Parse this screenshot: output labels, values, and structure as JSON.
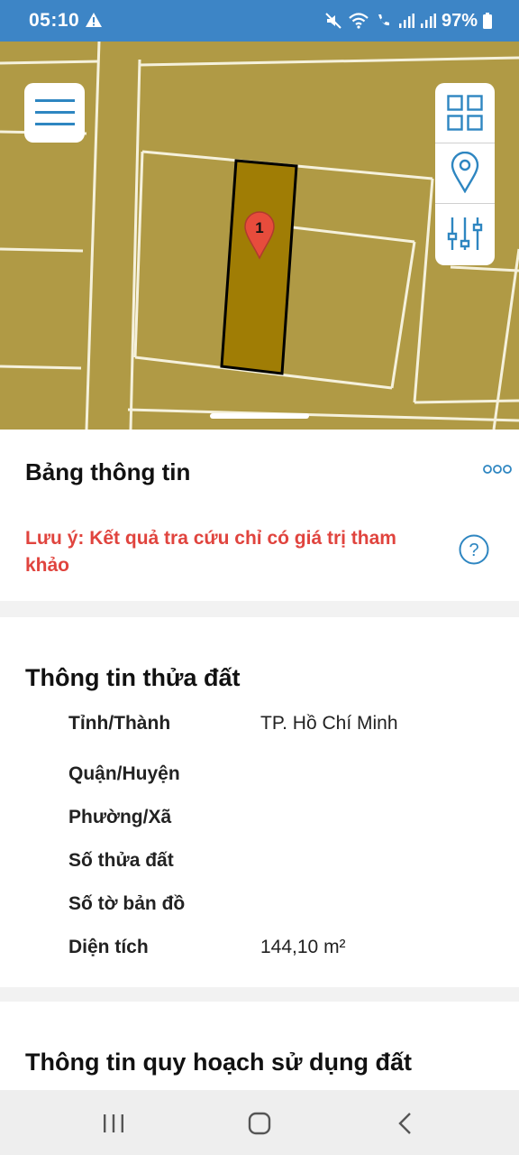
{
  "status": {
    "time": "05:10",
    "battery": "97%"
  },
  "map": {
    "marker_label": "1",
    "accent": "#2e86c1"
  },
  "panel": {
    "title": "Bảng thông tin",
    "note": "Lưu ý: Kết quả tra cứu chỉ có giá trị tham khảo"
  },
  "land_info": {
    "title": "Thông tin thửa đất",
    "rows": [
      {
        "label": "Tỉnh/Thành",
        "value": "TP. Hồ Chí Minh"
      },
      {
        "label": "Quận/Huyện",
        "value": ""
      },
      {
        "label": "Phường/Xã",
        "value": ""
      },
      {
        "label": "Số thửa đất",
        "value": ""
      },
      {
        "label": "Số tờ bản đồ",
        "value": ""
      },
      {
        "label": "Diện tích",
        "value": "144,10 m²"
      }
    ]
  },
  "planning": {
    "title": "Thông tin quy hoạch sử dụng đất"
  },
  "icons": {
    "menu": "hamburger-menu-icon",
    "layers": "grid-layers-icon",
    "location": "location-pin-icon",
    "filters": "sliders-icon",
    "more": "more-dots-icon",
    "help": "help-circle-icon"
  }
}
